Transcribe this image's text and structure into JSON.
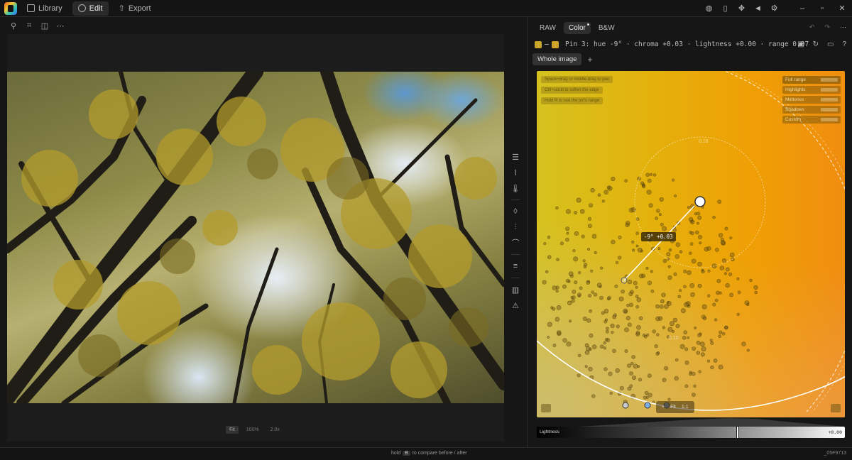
{
  "titlebar": {
    "tabs": [
      {
        "label": "Library",
        "icon": "library-icon"
      },
      {
        "label": "Edit",
        "icon": "edit-icon",
        "active": true
      },
      {
        "label": "Export",
        "icon": "export-icon"
      }
    ],
    "right_icons": [
      "globe-icon",
      "book-icon",
      "effects-icon",
      "megaphone-icon",
      "gear-icon"
    ],
    "window_controls": [
      "minimize",
      "restore",
      "close"
    ]
  },
  "left_tools": [
    "pin-icon",
    "crop-icon",
    "compare-icon",
    "more-icon"
  ],
  "zoom": {
    "fit": "Fit",
    "pct": "100%",
    "max": "2.0x"
  },
  "side_tools": [
    "sliders-icon",
    "chart-icon",
    "thermometer-icon",
    "drop-icon",
    "mixer-icon",
    "curve-icon",
    "levels-icon",
    "histogram-icon",
    "warning-icon"
  ],
  "panel": {
    "mode_tabs": [
      {
        "label": "RAW"
      },
      {
        "label": "Color",
        "active": true
      },
      {
        "label": "B&W"
      }
    ],
    "pin_text": "Pin 3: hue -9° · chroma +0.03 · lightness +0.00 · range 0.07",
    "pin_colors": {
      "from": "#c9a72a",
      "to": "#d2a32a"
    },
    "pin_icons": [
      "save-icon",
      "reset-icon",
      "keyboard-icon",
      "help-icon"
    ],
    "scope_tabs": [
      {
        "label": "Whole image"
      }
    ],
    "add_label": "+"
  },
  "plane": {
    "hints": [
      "Space+drag or middle-drag to pan",
      "Ctrl+scroll to soften the edge",
      "Hold R to see the pin's range"
    ],
    "presets": [
      {
        "label": "Full range",
        "active": true
      },
      {
        "label": "Highlights"
      },
      {
        "label": "Midtones"
      },
      {
        "label": "Shadows"
      },
      {
        "label": "Custom"
      }
    ],
    "chroma_label_top": "0.16",
    "chroma_label_bottom": "0.10",
    "pin_readout": "-9° +0.03",
    "controls": [
      "+",
      "Fit",
      "1:1"
    ]
  },
  "lightness": {
    "label": "Lightness",
    "value": "+0.00",
    "level": 0.65
  },
  "status": {
    "hint_pre": "hold",
    "hint_key": "B",
    "hint_post": "to compare before / after",
    "code": "_05F9713"
  }
}
